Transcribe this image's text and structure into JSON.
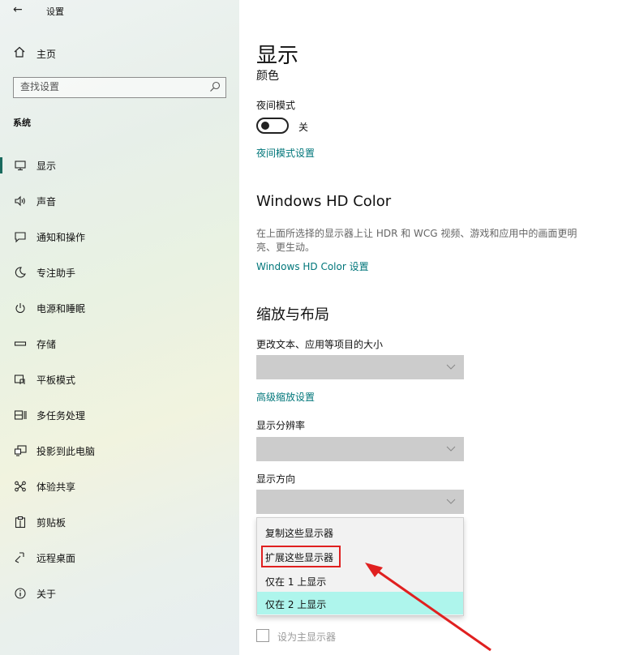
{
  "app": {
    "title": "设置"
  },
  "sidebar": {
    "home_label": "主页",
    "search": {
      "placeholder": "查找设置"
    },
    "section_label": "系统",
    "items": [
      {
        "label": "显示",
        "icon": "monitor-icon"
      },
      {
        "label": "声音",
        "icon": "speaker-icon"
      },
      {
        "label": "通知和操作",
        "icon": "notification-icon"
      },
      {
        "label": "专注助手",
        "icon": "moon-icon"
      },
      {
        "label": "电源和睡眠",
        "icon": "power-icon"
      },
      {
        "label": "存储",
        "icon": "storage-icon"
      },
      {
        "label": "平板模式",
        "icon": "tablet-icon"
      },
      {
        "label": "多任务处理",
        "icon": "multitask-icon"
      },
      {
        "label": "投影到此电脑",
        "icon": "project-icon"
      },
      {
        "label": "体验共享",
        "icon": "share-icon"
      },
      {
        "label": "剪贴板",
        "icon": "clipboard-icon"
      },
      {
        "label": "远程桌面",
        "icon": "remote-icon"
      },
      {
        "label": "关于",
        "icon": "info-icon"
      }
    ]
  },
  "main": {
    "title": "显示",
    "color_heading": "颜色",
    "night_light": {
      "label": "夜间模式",
      "toggle_state": "关",
      "settings_link": "夜间模式设置"
    },
    "hd_color": {
      "heading": "Windows HD Color",
      "description": "在上面所选择的显示器上让 HDR 和 WCG 视频、游戏和应用中的画面更明亮、更生动。",
      "link": "Windows HD Color 设置"
    },
    "scale_layout": {
      "heading": "缩放与布局",
      "scale_label": "更改文本、应用等项目的大小",
      "advanced_link": "高级缩放设置",
      "resolution_label": "显示分辨率",
      "orientation_label": "显示方向"
    },
    "multiple_displays_menu": {
      "options": [
        "复制这些显示器",
        "扩展这些显示器",
        "仅在 1 上显示",
        "仅在 2 上显示"
      ],
      "selected_index": 3,
      "annotated_index": 1
    },
    "primary_checkbox": {
      "label": "设为主显示器",
      "checked": false
    }
  },
  "colors": {
    "accent": "#00767a",
    "selected_option": "#aef5ec",
    "annotation": "#e02020",
    "dropdown_bg": "#cccccc"
  }
}
